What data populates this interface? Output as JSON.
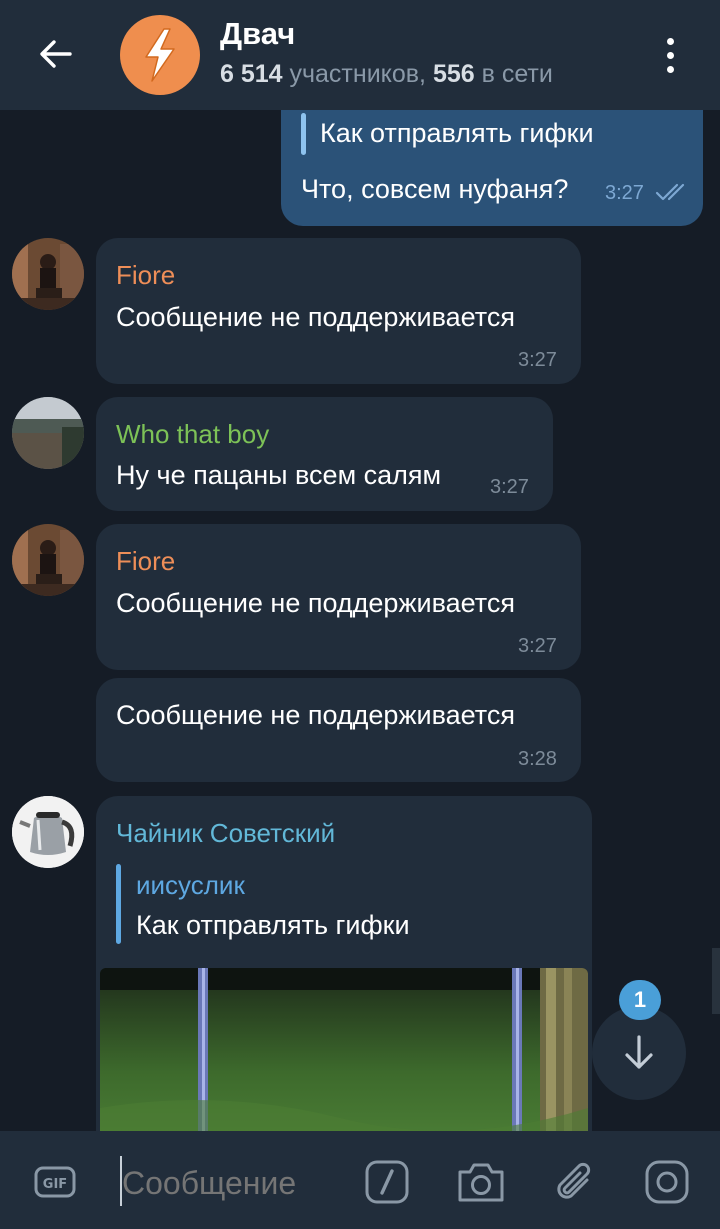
{
  "header": {
    "title": "Двач",
    "members": "6 514",
    "members_label": " участников, ",
    "online": "556",
    "online_label": " в сети"
  },
  "messages": {
    "outgoing": {
      "reply_text": "Как отправлять гифки",
      "text": "Что, совсем нуфаня?",
      "time": "3:27"
    },
    "m1": {
      "sender": "Fiore",
      "text": "Сообщение не поддерживается",
      "time": "3:27"
    },
    "m2": {
      "sender": "Who that boy",
      "text": "Ну че пацаны всем салям",
      "time": "3:27"
    },
    "m3": {
      "sender": "Fiore",
      "text": "Сообщение не поддерживается",
      "time": "3:27"
    },
    "m4": {
      "text": "Сообщение не поддерживается",
      "time": "3:28"
    },
    "m5": {
      "sender": "Чайник Советский",
      "reply_sender": "иисуслик",
      "reply_text": "Как отправлять гифки"
    }
  },
  "scroll_badge": "1",
  "input": {
    "placeholder": "Сообщение"
  },
  "colors": {
    "background": "#151c26",
    "header": "#212d3b",
    "bubble_in": "#212d3b",
    "bubble_out": "#2b5278",
    "name_fiore": "#ee8e58",
    "name_who": "#7dc257",
    "name_chainik": "#62b8d8",
    "reply_accent": "#5ea8e2",
    "badge": "#4a9fd8"
  },
  "icons": [
    "back-arrow-icon",
    "lightning-icon",
    "more-vert-icon",
    "double-check-icon",
    "arrow-down-icon",
    "gif-icon",
    "slash-command-icon",
    "camera-icon",
    "attach-icon",
    "record-video-icon"
  ]
}
